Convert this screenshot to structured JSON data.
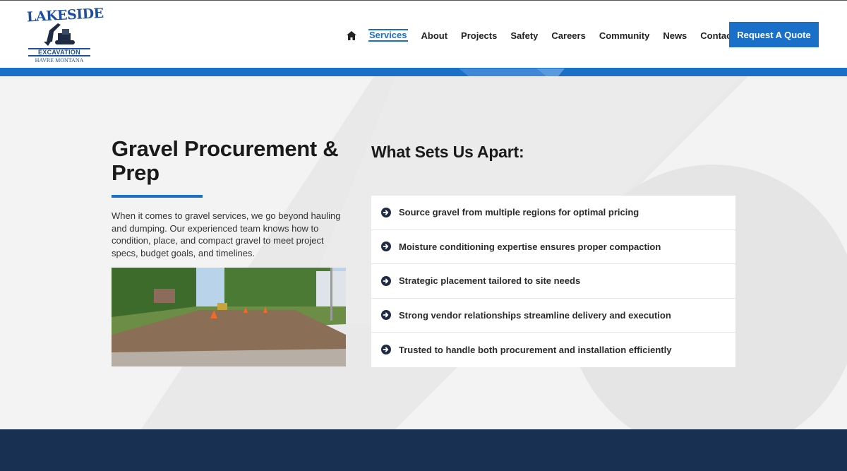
{
  "header": {
    "logo": {
      "title": "LAKESIDE",
      "bar_text": "EXCAVATION",
      "subtitle": "HAVRE MONTANA"
    },
    "nav": {
      "home_icon": "home-icon",
      "items": [
        {
          "label": "Services",
          "active": true
        },
        {
          "label": "About",
          "active": false
        },
        {
          "label": "Projects",
          "active": false
        },
        {
          "label": "Safety",
          "active": false
        },
        {
          "label": "Careers",
          "active": false
        },
        {
          "label": "Community",
          "active": false
        },
        {
          "label": "News",
          "active": false
        },
        {
          "label": "Contact",
          "active": false
        }
      ]
    },
    "cta_label": "Request A Quote"
  },
  "main": {
    "heading": "Gravel Procurement & Prep",
    "intro": "When it comes to gravel services, we go beyond hauling and dumping. Our experienced team knows how to condition, place, and compact gravel to meet project specs, budget goals, and timelines.",
    "apart_heading": "What Sets Us Apart:",
    "features": [
      "Source gravel from multiple regions for optimal pricing",
      "Moisture conditioning expertise ensures proper compaction",
      "Strategic placement tailored to site needs",
      "Strong vendor relationships streamline delivery and execution",
      "Trusted to handle both procurement and installation efficiently"
    ],
    "feature_icon": "arrow-circle-right-icon"
  },
  "colors": {
    "brand_blue": "#1a6fc9",
    "footer_navy": "#183153",
    "logo_blue": "#1c4fa0"
  }
}
